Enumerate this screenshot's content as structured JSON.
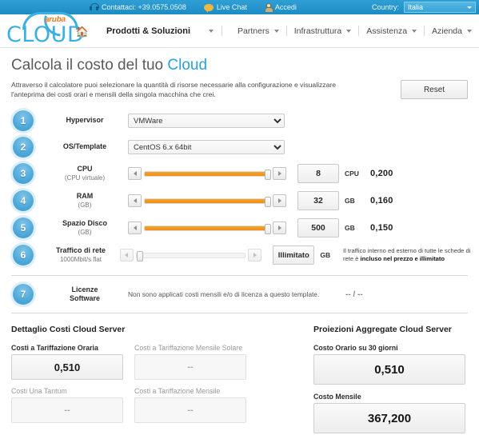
{
  "topbar": {
    "contact_label": "Contattaci: +39.0575.0508",
    "livechat_label": "Live Chat",
    "login_label": "Accedi",
    "country_label": "Country:",
    "country_value": "Italia"
  },
  "header": {
    "logo_aruba": "aruba",
    "logo_cloud": "CLOUD",
    "nav": [
      {
        "label": "Prodotti & Soluzioni",
        "primary": true
      },
      {
        "label": "Partners",
        "primary": false
      },
      {
        "label": "Infrastruttura",
        "primary": false
      },
      {
        "label": "Assistenza",
        "primary": false
      },
      {
        "label": "Azienda",
        "primary": false
      }
    ]
  },
  "page": {
    "title_main": "Calcola il costo del tuo ",
    "title_highlight": "Cloud",
    "intro": "Attraverso il calcolatore puoi selezionare la quantità di risorse necessarie alla configurazione e visualizzare l'anteprima dei costi orari e mensili della singola macchina che crei.",
    "reset_label": "Reset"
  },
  "config": {
    "row1": {
      "number": "1",
      "label": "Hypervisor",
      "value": "VMWare",
      "options": [
        "VMWare"
      ]
    },
    "row2": {
      "number": "2",
      "label": "OS/Template",
      "value": "CentOS 6.x 64bit",
      "options": [
        "CentOS 6.x 64bit"
      ]
    },
    "row3": {
      "number": "3",
      "label": "CPU",
      "sublabel": "(CPU virtuale)",
      "value": "8",
      "unit": "CPU",
      "price": "0,200",
      "slider_percent": 100
    },
    "row4": {
      "number": "4",
      "label": "RAM",
      "sublabel": "(GB)",
      "value": "32",
      "unit": "GB",
      "price": "0,160",
      "slider_percent": 100
    },
    "row5": {
      "number": "5",
      "label": "Spazio Disco",
      "sublabel": "(GB)",
      "value": "500",
      "unit": "GB",
      "price": "0,150",
      "slider_percent": 100
    },
    "row6": {
      "number": "6",
      "label": "Traffico di rete",
      "sublabel": "1000Mbit/s flat",
      "value": "Illimitato",
      "unit": "GB",
      "note_line1": "Il traffico interno ed esterno di tutte le",
      "note_line2_plain": "schede di rete è ",
      "note_line2_bold": "incluso nel prezzo e illimitato",
      "slider_percent": 0
    },
    "row7": {
      "number": "7",
      "label": "Licenze",
      "sublabel": "Software",
      "description": "Non sono applicati costi mensili e/o di licenza a questo template.",
      "value": "-- / --"
    }
  },
  "summary": {
    "left_title": "Dettaglio Costi Cloud Server",
    "cells": [
      {
        "label": "Costi a Tariffazione Oraria",
        "value": "0,510",
        "muted": false
      },
      {
        "label": "Costi a Tariffazione Mensile Solare",
        "value": "--",
        "muted": true
      },
      {
        "label": "Costi Una Tantum",
        "value": "--",
        "muted": true
      },
      {
        "label": "Costi a Tariffazione Mensile",
        "value": "--",
        "muted": true
      }
    ],
    "right_title": "Proiezioni Aggregate Cloud Server",
    "projections": [
      {
        "label": "Costo Orario su 30 giorni",
        "value": "0,510"
      },
      {
        "label": "Costo Mensile",
        "value": "367,200"
      }
    ]
  },
  "colors": {
    "brand_blue": "#3bb0e0",
    "brand_orange": "#ef7d22",
    "slider_fill": "#f29116",
    "topbar_blue": "#2293cc"
  }
}
